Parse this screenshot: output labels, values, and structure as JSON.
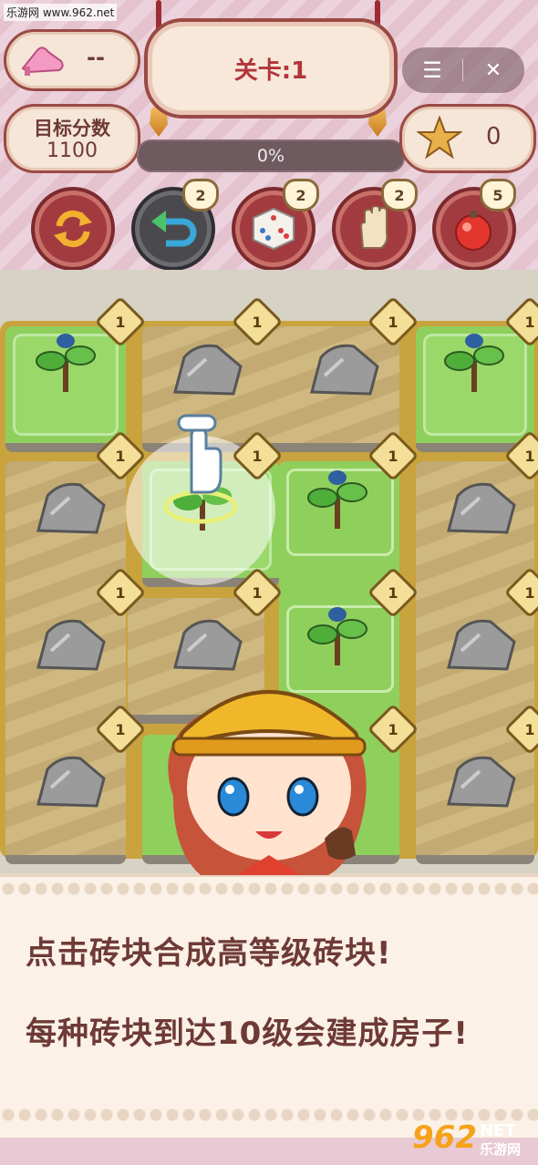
{
  "watermark": "乐游网 www.962.net",
  "level": {
    "label": "关卡:1"
  },
  "shoe_counter": {
    "value": "--"
  },
  "target": {
    "label": "目标分数",
    "value": "1100"
  },
  "progress": {
    "percent": 0,
    "text": "0%"
  },
  "stars": {
    "value": "0"
  },
  "menu": {
    "menu_icon": "☰",
    "close_icon": "✕"
  },
  "tools": [
    {
      "name": "shuffle",
      "count": null
    },
    {
      "name": "undo",
      "count": "2"
    },
    {
      "name": "dice",
      "count": "2"
    },
    {
      "name": "hand",
      "count": "2"
    },
    {
      "name": "potion",
      "count": "5"
    }
  ],
  "tile_levels": [
    "1",
    "1",
    "1",
    "1",
    "1",
    "1",
    "1",
    "1",
    "1",
    "1",
    "1",
    "1",
    "1",
    "1",
    "1",
    "1",
    "1",
    "1",
    "1"
  ],
  "dialog": {
    "line1": "点击砖块合成高等级砖块!",
    "line2": "每种砖块到达10级会建成房子!"
  },
  "logo": {
    "text": "962",
    "suffix": "NET",
    "sub": "乐游网"
  },
  "colors": {
    "accent": "#9a4a45",
    "sign_text": "#b2353b",
    "grass": "#8fcf5c",
    "dirt": "#cbb37a",
    "gold": "#c9a33e"
  }
}
